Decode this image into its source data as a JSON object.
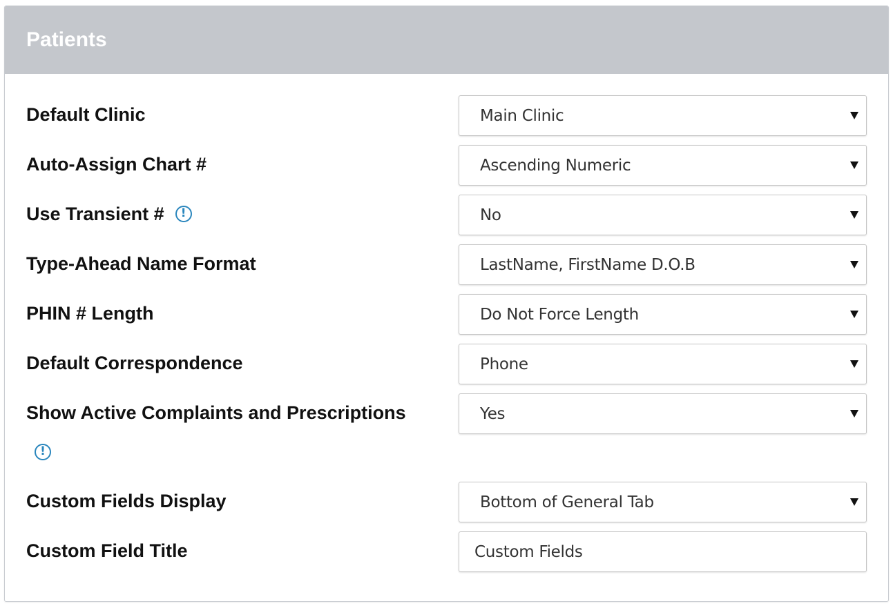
{
  "panel": {
    "title": "Patients"
  },
  "fields": [
    {
      "label": "Default Clinic",
      "value": "Main Clinic"
    },
    {
      "label": "Auto-Assign Chart #",
      "value": "Ascending Numeric"
    },
    {
      "label": "Use Transient #",
      "value": "No",
      "info_icon": "info-icon"
    },
    {
      "label": "Type-Ahead Name Format",
      "value": "LastName, FirstName D.O.B"
    },
    {
      "label": "PHIN # Length",
      "value": "Do Not Force Length"
    },
    {
      "label": "Default Correspondence",
      "value": "Phone"
    },
    {
      "label": "Show Active Complaints and Prescriptions",
      "value": "Yes",
      "info_icon": "info-icon"
    },
    {
      "label": "Custom Fields Display",
      "value": "Bottom of General Tab"
    },
    {
      "label": "Custom Field Title",
      "value": "Custom Fields"
    }
  ],
  "icons": {
    "info_glyph": "!",
    "info_color": "#2a86bd"
  },
  "colors": {
    "header_bg": "#c4c7cc",
    "header_text": "#ffffff",
    "label_text": "#111111"
  }
}
